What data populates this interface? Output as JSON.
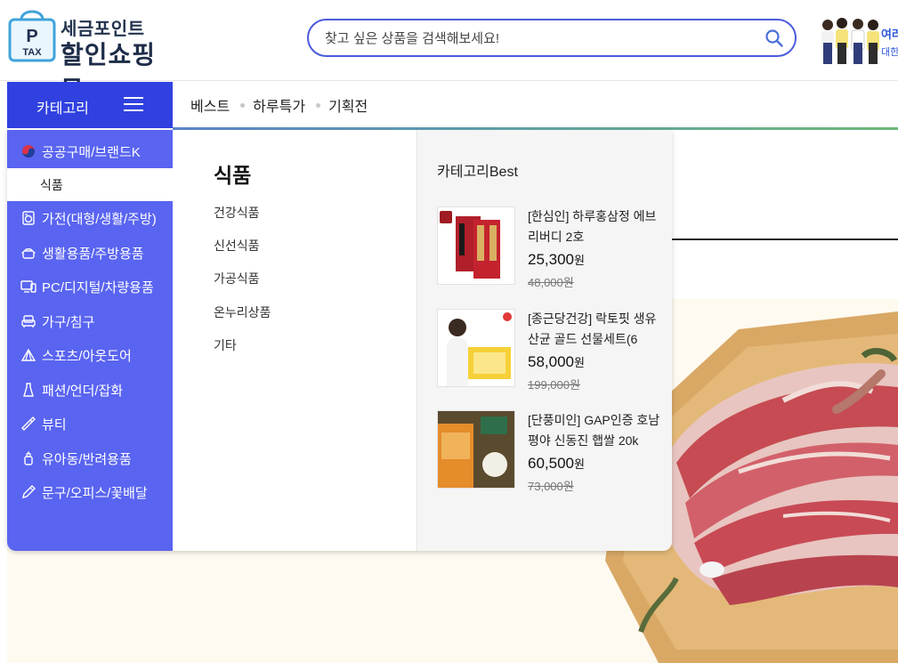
{
  "header": {
    "logo_top": "세금포인트",
    "logo_main": "할인쇼핑몰",
    "logo_bag_text": "TAX",
    "logo_bag_letter": "P",
    "search_placeholder": "찾고 싶은 상품을 검색해보세요!",
    "promo_line1": "여러",
    "promo_line2": "대한"
  },
  "nav": {
    "category_label": "카테고리",
    "links": [
      "베스트",
      "하루특가",
      "기획전"
    ]
  },
  "sidebar": {
    "items": [
      {
        "label": "공공구매/브랜드K",
        "icon": "taeguk-icon"
      },
      {
        "label": "식품",
        "icon": "",
        "active": true
      },
      {
        "label": "가전(대형/생활/주방)",
        "icon": "washer-icon"
      },
      {
        "label": "생활용품/주방용품",
        "icon": "pot-icon"
      },
      {
        "label": "PC/디지털/차량용품",
        "icon": "monitor-icon"
      },
      {
        "label": "가구/침구",
        "icon": "sofa-icon"
      },
      {
        "label": "스포츠/아웃도어",
        "icon": "tent-icon"
      },
      {
        "label": "패션/언더/잡화",
        "icon": "dress-icon"
      },
      {
        "label": "뷰티",
        "icon": "lipstick-icon"
      },
      {
        "label": "유아동/반려용품",
        "icon": "bottle-icon"
      },
      {
        "label": "문구/오피스/꽃배달",
        "icon": "pen-icon"
      }
    ]
  },
  "submenu": {
    "title": "식품",
    "items": [
      "건강식품",
      "신선식품",
      "가공식품",
      "온누리상품",
      "기타"
    ]
  },
  "best": {
    "title": "카테고리Best",
    "products": [
      {
        "name": "[한심인] 하루홍삼정 에브리버디 2호",
        "price": "25,300",
        "unit": "원",
        "original": "48,000원"
      },
      {
        "name": "[종근당건강] 락토핏 생유산균 골드 선물세트(6",
        "price": "58,000",
        "unit": "원",
        "original": "199,000원"
      },
      {
        "name": "[단풍미인] GAP인증 호남평야 신동진 햅쌀 20k",
        "price": "60,500",
        "unit": "원",
        "original": "73,000원"
      }
    ]
  },
  "colors": {
    "primary": "#3041e0",
    "sidebar": "#5964f0",
    "search_border": "#4a5bdc"
  }
}
